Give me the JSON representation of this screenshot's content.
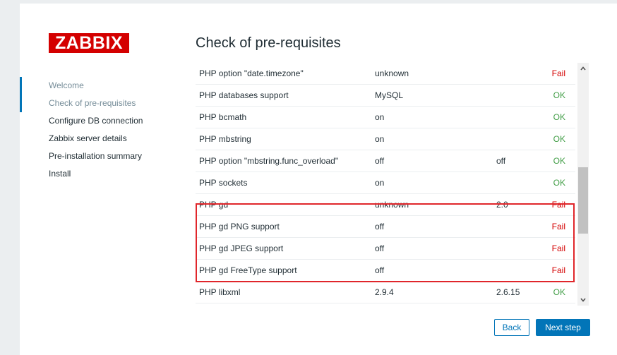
{
  "logo": {
    "text": "ZABBIX"
  },
  "title": "Check of pre-requisites",
  "nav": [
    {
      "label": "Welcome",
      "state": "done"
    },
    {
      "label": "Check of pre-requisites",
      "state": "current"
    },
    {
      "label": "Configure DB connection",
      "state": "todo"
    },
    {
      "label": "Zabbix server details",
      "state": "todo"
    },
    {
      "label": "Pre-installation summary",
      "state": "todo"
    },
    {
      "label": "Install",
      "state": "todo"
    }
  ],
  "rows": [
    {
      "name": "PHP option \"date.timezone\"",
      "current": "unknown",
      "required": "",
      "result": "Fail"
    },
    {
      "name": "PHP databases support",
      "current": "MySQL",
      "required": "",
      "result": "OK"
    },
    {
      "name": "PHP bcmath",
      "current": "on",
      "required": "",
      "result": "OK"
    },
    {
      "name": "PHP mbstring",
      "current": "on",
      "required": "",
      "result": "OK"
    },
    {
      "name": "PHP option \"mbstring.func_overload\"",
      "current": "off",
      "required": "off",
      "result": "OK"
    },
    {
      "name": "PHP sockets",
      "current": "on",
      "required": "",
      "result": "OK"
    },
    {
      "name": "PHP gd",
      "current": "unknown",
      "required": "2.0",
      "result": "Fail"
    },
    {
      "name": "PHP gd PNG support",
      "current": "off",
      "required": "",
      "result": "Fail"
    },
    {
      "name": "PHP gd JPEG support",
      "current": "off",
      "required": "",
      "result": "Fail"
    },
    {
      "name": "PHP gd FreeType support",
      "current": "off",
      "required": "",
      "result": "Fail"
    },
    {
      "name": "PHP libxml",
      "current": "2.9.4",
      "required": "2.6.15",
      "result": "OK"
    }
  ],
  "buttons": {
    "back": "Back",
    "next": "Next step"
  },
  "colors": {
    "brand": "#d40000",
    "ok": "#429e47",
    "fail": "#d40000",
    "accent": "#0275b8",
    "highlight": "#e0262b"
  },
  "icons": {
    "scroll_up": "chevron-up-icon",
    "scroll_down": "chevron-down-icon"
  }
}
